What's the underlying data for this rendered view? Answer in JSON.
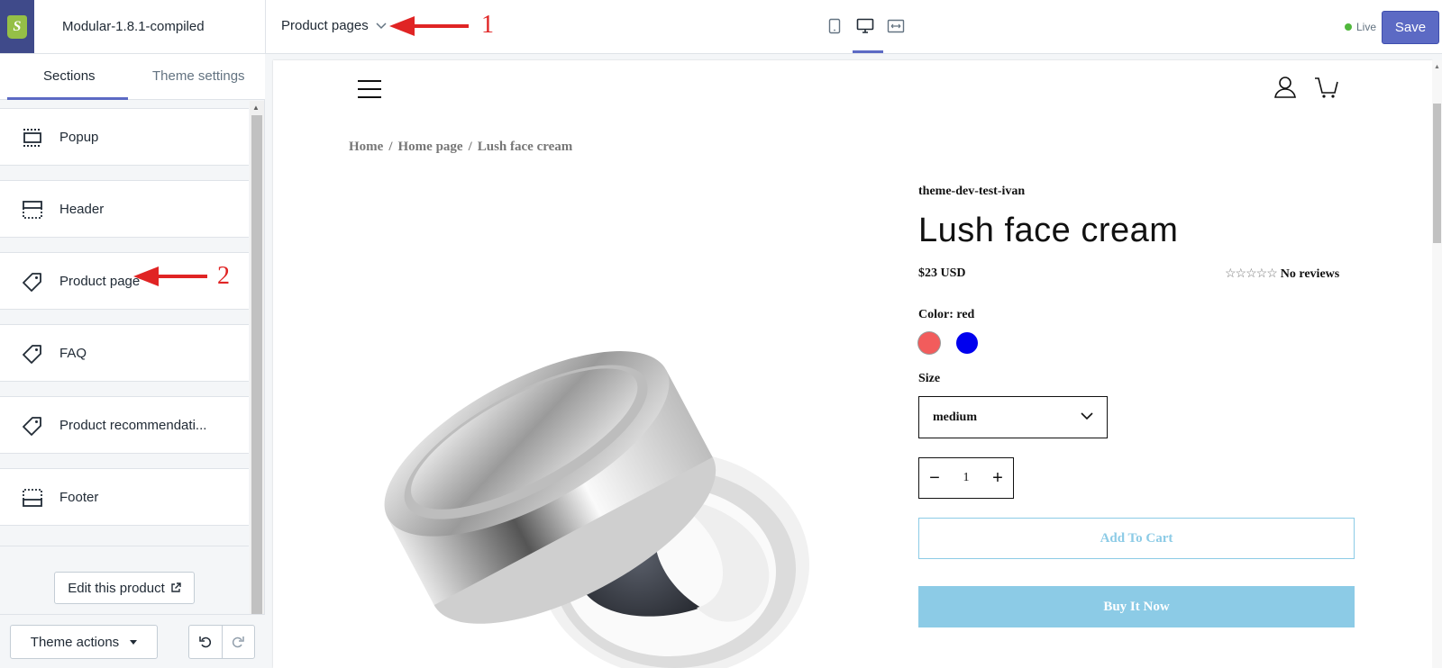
{
  "topbar": {
    "theme_name": "Modular-1.8.1-compiled",
    "page_select": "Product pages",
    "live_label": "Live",
    "save_label": "Save",
    "devices": [
      "mobile-icon",
      "desktop-icon",
      "fullscreen-icon"
    ],
    "active_device": "desktop-icon"
  },
  "annotations": {
    "one": "1",
    "two": "2",
    "color": "#e02424"
  },
  "sidebar": {
    "tabs": [
      {
        "label": "Sections",
        "active": true
      },
      {
        "label": "Theme settings",
        "active": false
      }
    ],
    "sections": [
      {
        "label": "Popup",
        "icon": "popup-section-icon"
      },
      {
        "label": "Header",
        "icon": "header-section-icon"
      },
      {
        "label": "Product page",
        "icon": "tag-icon"
      },
      {
        "label": "FAQ",
        "icon": "tag-icon"
      },
      {
        "label": "Product recommendati...",
        "icon": "tag-icon"
      },
      {
        "label": "Footer",
        "icon": "footer-section-icon"
      }
    ],
    "edit_product_label": "Edit this product",
    "theme_actions_label": "Theme actions"
  },
  "preview": {
    "breadcrumb": [
      "Home",
      "/",
      "Home page",
      "/",
      "Lush face cream"
    ],
    "vendor": "theme-dev-test-ivan",
    "title": "Lush face cream",
    "price": "$23 USD",
    "stars": "☆☆☆☆☆",
    "reviews": "No reviews",
    "color_label": "Color: red",
    "swatches": [
      {
        "name": "red",
        "hex": "#f25c5c"
      },
      {
        "name": "blue",
        "hex": "#0000ee"
      }
    ],
    "size_label": "Size",
    "size_value": "medium",
    "quantity": "1",
    "add_to_cart": "Add To Cart",
    "buy_now": "Buy It Now"
  },
  "colors": {
    "accent": "#5c6ac4",
    "button_blue": "#8ccbe6",
    "live_green": "#50b83c"
  }
}
